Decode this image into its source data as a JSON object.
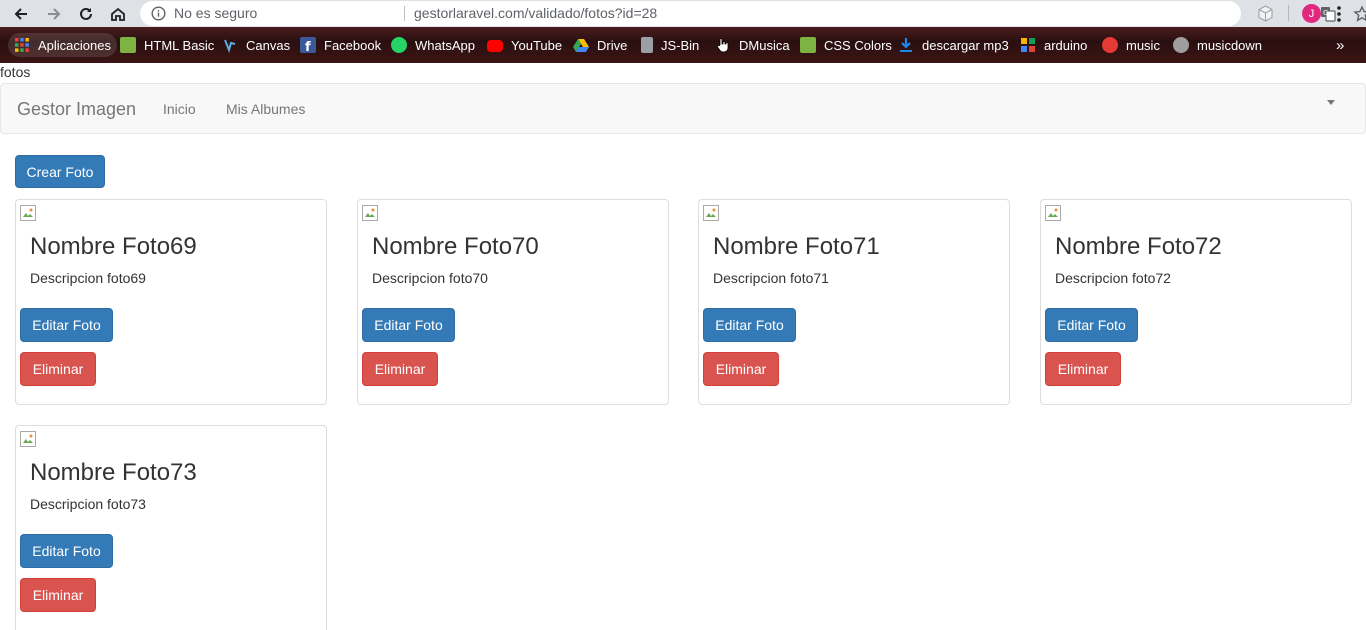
{
  "browser": {
    "security_label": "No es seguro",
    "url": "gestorlaravel.com/validado/fotos?id=28",
    "avatar_initial": "J"
  },
  "bookmarks": {
    "apps_label": "Aplicaciones",
    "items": [
      {
        "label": "HTML Basic",
        "icon": "html-basic-icon",
        "color": "#7cb342"
      },
      {
        "label": "Canvas",
        "icon": "canvas-icon",
        "color": "#1e88e5"
      },
      {
        "label": "Facebook",
        "icon": "facebook-icon",
        "color": "#3b5998"
      },
      {
        "label": "WhatsApp",
        "icon": "whatsapp-icon",
        "color": "#25d366"
      },
      {
        "label": "YouTube",
        "icon": "youtube-icon",
        "color": "#ff0000"
      },
      {
        "label": "Drive",
        "icon": "drive-icon",
        "color": "#fbbc04"
      },
      {
        "label": "JS-Bin",
        "icon": "jsbin-icon",
        "color": "#9aa0a6"
      },
      {
        "label": "DMusica",
        "icon": "dmusica-icon",
        "color": "#ffffff"
      },
      {
        "label": "CSS Colors",
        "icon": "css-colors-icon",
        "color": "#7cb342"
      },
      {
        "label": "descargar mp3",
        "icon": "download-icon",
        "color": "#1e88e5"
      },
      {
        "label": "arduino",
        "icon": "arduino-icon",
        "color": "#f4b400"
      },
      {
        "label": "music",
        "icon": "music-icon",
        "color": "#e53935"
      },
      {
        "label": "musicdown",
        "icon": "musicdown-icon",
        "color": "#9e9e9e"
      }
    ]
  },
  "page": {
    "title": "fotos"
  },
  "navbar": {
    "brand": "Gestor Imagen",
    "links": [
      "Inicio",
      "Mis Albumes"
    ]
  },
  "actions": {
    "create_label": "Crear Foto"
  },
  "photos": [
    {
      "name": "Nombre Foto69",
      "description": "Descripcion foto69",
      "edit_label": "Editar Foto",
      "delete_label": "Eliminar"
    },
    {
      "name": "Nombre Foto70",
      "description": "Descripcion foto70",
      "edit_label": "Editar Foto",
      "delete_label": "Eliminar"
    },
    {
      "name": "Nombre Foto71",
      "description": "Descripcion foto71",
      "edit_label": "Editar Foto",
      "delete_label": "Eliminar"
    },
    {
      "name": "Nombre Foto72",
      "description": "Descripcion foto72",
      "edit_label": "Editar Foto",
      "delete_label": "Eliminar"
    },
    {
      "name": "Nombre Foto73",
      "description": "Descripcion foto73",
      "edit_label": "Editar Foto",
      "delete_label": "Eliminar"
    }
  ],
  "colors": {
    "primary": "#337ab7",
    "danger": "#d9534f"
  }
}
